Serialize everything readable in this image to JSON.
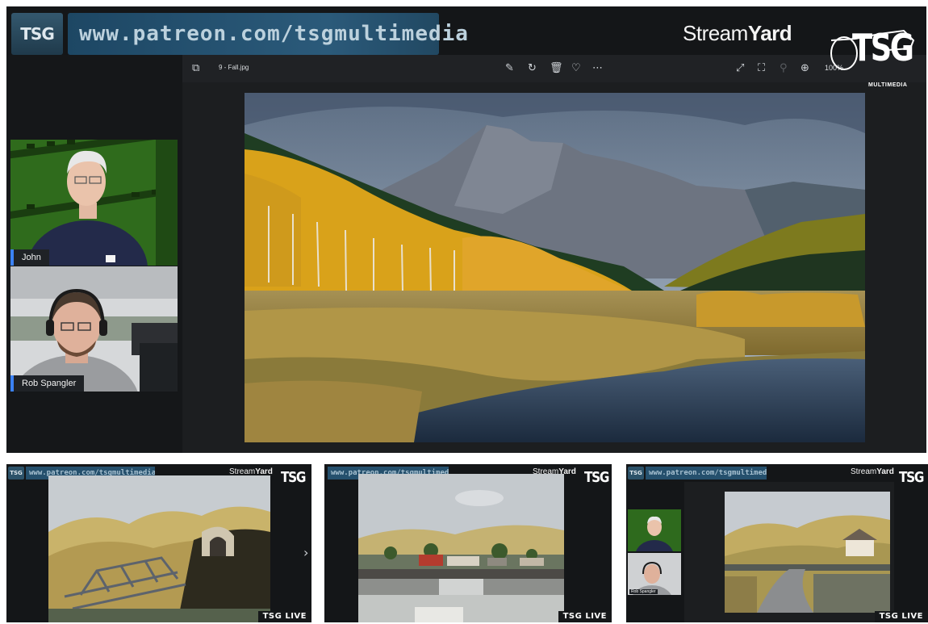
{
  "stream": {
    "brand_badge": "TSG",
    "banner_url": "www.patreon.com/tsgmultimedia",
    "streamyard_regular": "Stream",
    "streamyard_bold": "Yard",
    "channel_logo": "TSG",
    "channel_logo_sub": "MULTIMEDIA"
  },
  "viewer": {
    "file_name": "9 - Fall.jpg",
    "zoom_level": "100%",
    "icons": [
      "gallery-icon",
      "edit-icon",
      "rotate-icon",
      "delete-icon",
      "favorite-icon",
      "more-icon",
      "fullscreen-icon",
      "fit-icon",
      "zoom-out-icon",
      "zoom-in-icon"
    ]
  },
  "participants": [
    {
      "name": "John"
    },
    {
      "name": "Rob Spangler"
    }
  ],
  "thumbnails": [
    {
      "url": "www.patreon.com/tsgmultimedia",
      "streamyard_regular": "Stream",
      "streamyard_bold": "Yard",
      "logo": "TSG",
      "live_label": "TSG LIVE"
    },
    {
      "url": "www.patreon.com/tsgmultimedia",
      "streamyard_regular": "Stream",
      "streamyard_bold": "Yard",
      "logo": "TSG",
      "live_label": "TSG LIVE"
    },
    {
      "url": "www.patreon.com/tsgmultimedia",
      "streamyard_regular": "Stream",
      "streamyard_bold": "Yard",
      "logo": "TSG",
      "live_label": "TSG LIVE"
    }
  ],
  "thumbnail3_participants": [
    {
      "name": "Rob Spangler"
    }
  ],
  "colors": {
    "frame_bg": "#151719",
    "banner": "#2b5a7a",
    "name_tag_accent": "#3b82f6"
  }
}
